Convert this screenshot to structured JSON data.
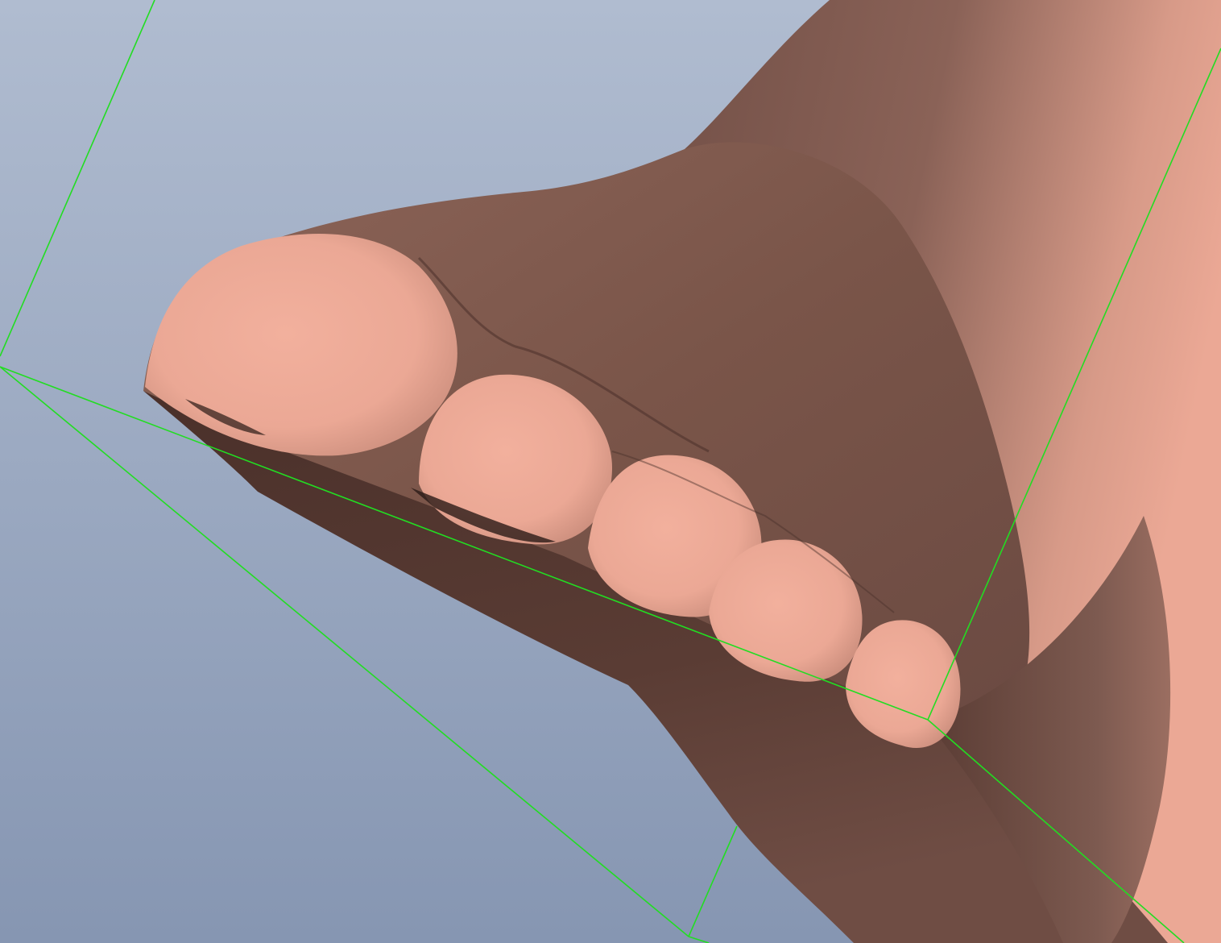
{
  "viewport": {
    "background_top": "#b0bcd0",
    "background_bottom": "#8696b2"
  },
  "model": {
    "name": "foot-mesh",
    "skin_light": "#eba895",
    "skin_mid": "#a9766a",
    "skin_dark": "#6b4a42",
    "skin_shadow": "#3b2622"
  },
  "bounding_box": {
    "color": "#22dd22"
  }
}
